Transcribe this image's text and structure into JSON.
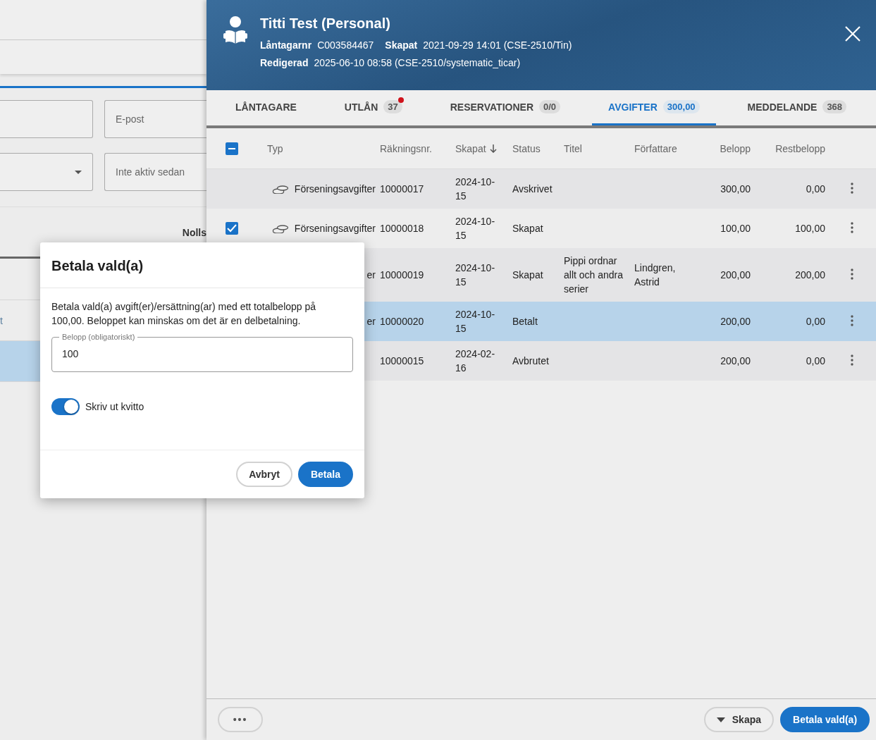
{
  "background_form": {
    "fields": [
      {
        "kind": "text"
      },
      {
        "kind": "text",
        "placeholder": "E-post"
      },
      {
        "kind": "dropdown"
      },
      {
        "kind": "text",
        "placeholder": "Inte aktiv sedan"
      }
    ],
    "cut_label": "Nolls",
    "list_rows": [
      {
        "text": "t",
        "selected": false
      },
      {
        "selected": true
      }
    ]
  },
  "panel": {
    "header": {
      "title": "Titti Test (Personal)",
      "details": [
        [
          {
            "label": "Låntagarnr",
            "value": "C003584467"
          },
          {
            "label": "Skapat",
            "value": "2021-09-29 14:01 (CSE-2510/Tin)"
          }
        ],
        [
          {
            "label": "Redigerad",
            "value": "2025-06-10 08:58 (CSE-2510/systematic_ticar)"
          }
        ]
      ]
    },
    "tabs": [
      {
        "label": "LÅNTAGARE",
        "selected": false,
        "alert": false
      },
      {
        "label": "UTLÅN",
        "badge": "37",
        "selected": false,
        "alert": true
      },
      {
        "label": "RESERVATIONER",
        "badge": "0/0",
        "selected": false,
        "alert": false
      },
      {
        "label": "AVGIFTER",
        "badge": "300,00",
        "selected": true,
        "alert": false
      },
      {
        "label": "MEDDELANDE",
        "badge": "368",
        "selected": false,
        "alert": false
      }
    ],
    "table": {
      "select_all": {
        "indeterminate": true
      },
      "columns": [
        {
          "label": "Typ",
          "sorted": false
        },
        {
          "label": "Räkningsnr.",
          "sorted": false
        },
        {
          "label": "Skapat",
          "sorted": true
        },
        {
          "label": "Status",
          "sorted": false
        },
        {
          "label": "Titel",
          "sorted": false
        },
        {
          "label": "Författare",
          "sorted": false
        },
        {
          "label": "Belopp",
          "sorted": false
        },
        {
          "label": "Restbelopp",
          "sorted": false
        }
      ],
      "rows": [
        {
          "checked": false,
          "selected": false,
          "icon": true,
          "type": "Förseningsavgifter",
          "number": "10000017",
          "created": "2024-10-15",
          "status": "Avskrivet",
          "amount": "300,00",
          "remaining": "0,00"
        },
        {
          "checked": true,
          "selected": false,
          "icon": true,
          "type": "Förseningsavgifter",
          "number": "10000018",
          "created": "2024-10-15",
          "status": "Skapat",
          "amount": "100,00",
          "remaining": "100,00"
        },
        {
          "checked": false,
          "selected": false,
          "type": "er",
          "number": "10000019",
          "created": "2024-10-15",
          "status": "Skapat",
          "title": "Pippi ordnar allt och andra serier",
          "author": "Lindgren, Astrid",
          "amount": "200,00",
          "remaining": "200,00"
        },
        {
          "checked": false,
          "selected": true,
          "type": "er",
          "number": "10000020",
          "created": "2024-10-15",
          "status": "Betalt",
          "amount": "200,00",
          "remaining": "0,00"
        },
        {
          "checked": false,
          "selected": false,
          "number": "10000015",
          "created": "2024-02-16",
          "status": "Avbrutet",
          "amount": "200,00",
          "remaining": "0,00"
        }
      ]
    },
    "footer": {
      "more_button": "•••",
      "create_button": "Skapa",
      "pay_button": "Betala vald(a)"
    }
  },
  "dialog": {
    "title": "Betala vald(a)",
    "message": "Betala vald(a) avgift(er)/ersättning(ar) med ett totalbelopp på 100,00. Beloppet kan minskas om det är en delbetalning.",
    "amount_field": {
      "label": "Belopp (obligatoriskt)",
      "value": "100"
    },
    "toggle": {
      "label": "Skriv ut kvitto",
      "on": true
    },
    "buttons": [
      {
        "label": "Avbryt",
        "kind": "secondary"
      },
      {
        "label": "Betala",
        "kind": "primary"
      }
    ]
  }
}
